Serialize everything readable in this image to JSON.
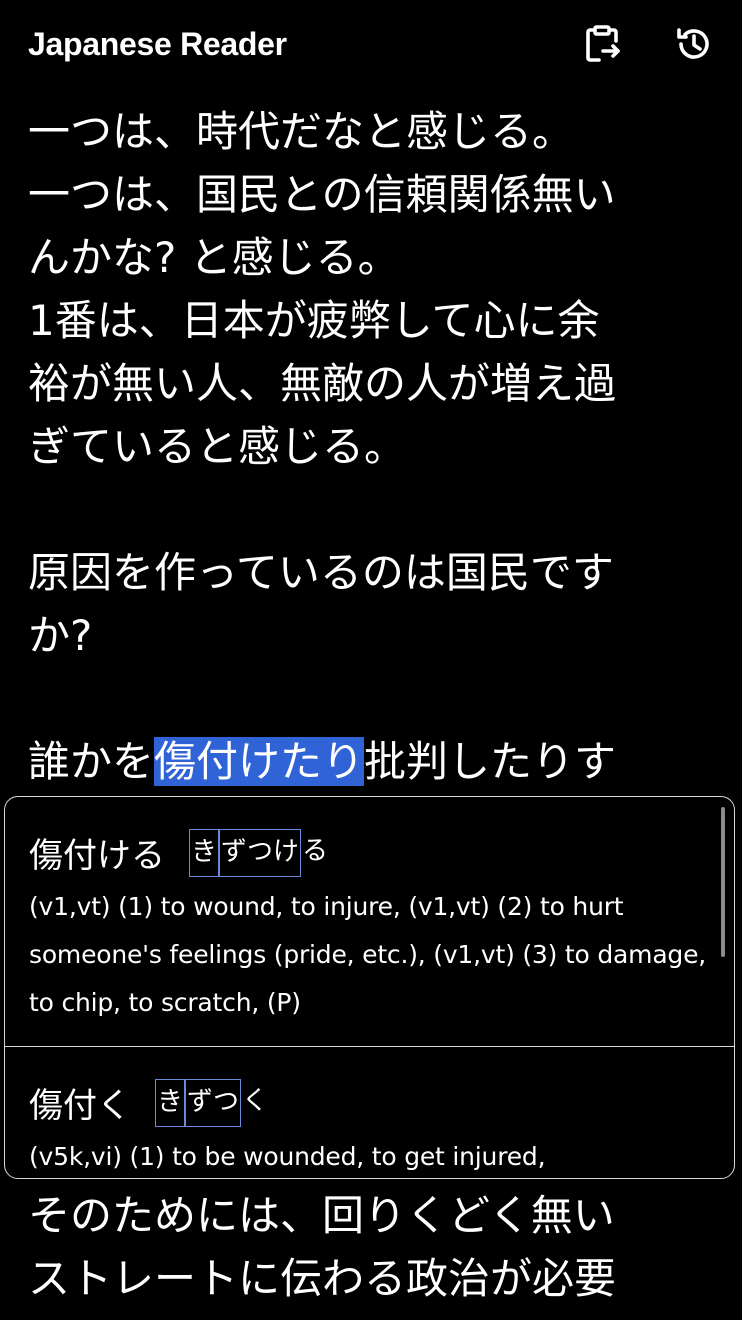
{
  "header": {
    "title": "Japanese Reader",
    "paste_icon": "clipboard-paste-icon",
    "history_icon": "history-icon"
  },
  "reader": {
    "lines": [
      "一つは、時代だなと感じる。",
      "一つは、国民との信頼関係無い",
      "んかな?  と感じる。",
      "1番は、日本が疲弊して心に余",
      "裕が無い人、無敵の人が増え過",
      "ぎていると感じる。",
      "",
      "原因を作っているのは国民です",
      "か?",
      ""
    ],
    "highlight_line": {
      "before": "誰かを",
      "selected": "傷付けたり",
      "after": "批判したりす"
    },
    "bottom_lines": [
      "そのためには、回りくどく無い",
      "ストレートに伝わる政治が必要"
    ]
  },
  "popup": {
    "entries": [
      {
        "term": "傷付ける",
        "reading_parts": [
          {
            "text": "き",
            "boxed": true
          },
          {
            "text": "ずつけ",
            "boxed": true
          },
          {
            "text": "る",
            "boxed": false
          }
        ],
        "gloss": "(v1,vt) (1) to wound, to injure, (v1,vt) (2) to hurt someone's feelings (pride, etc.), (v1,vt) (3) to damage, to chip, to scratch, (P)"
      },
      {
        "term": "傷付く",
        "reading_parts": [
          {
            "text": "き",
            "boxed": true
          },
          {
            "text": "ずつ",
            "boxed": true
          },
          {
            "text": "く",
            "boxed": false
          }
        ],
        "gloss": "(v5k,vi) (1) to be wounded, to get injured,"
      }
    ]
  },
  "colors": {
    "background": "#000000",
    "text": "#ffffff",
    "highlight": "#2f63d6",
    "reading_box": "#6a8bd9",
    "popup_border": "#d8d8d8"
  }
}
